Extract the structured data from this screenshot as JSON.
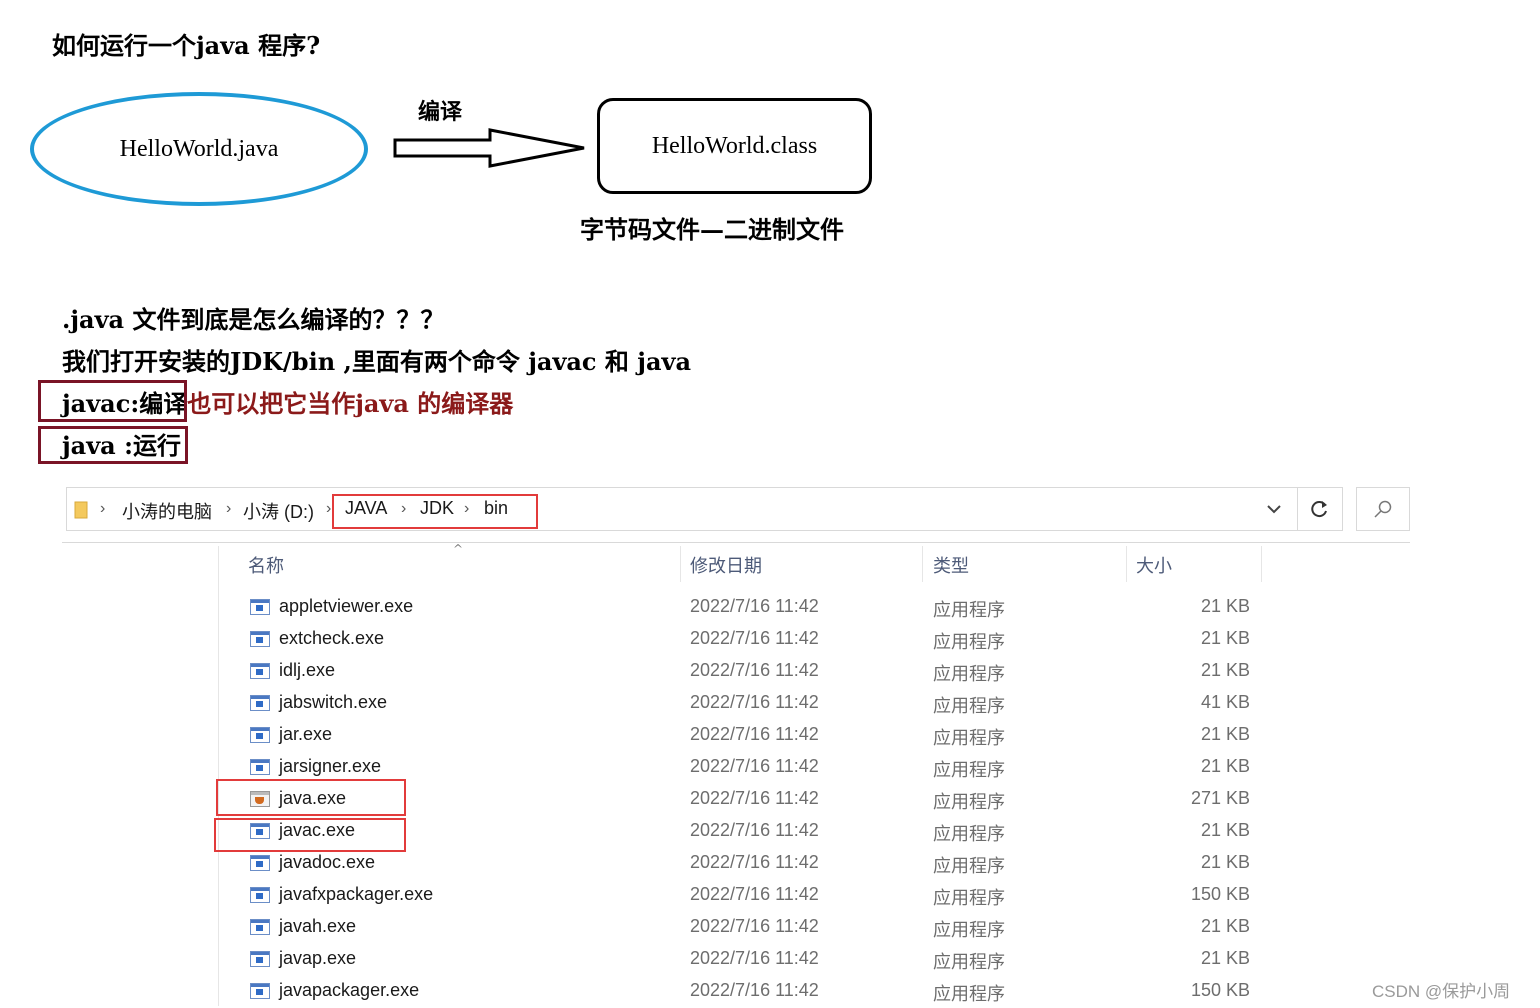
{
  "diagram": {
    "title": "如何运行一个java 程序?",
    "source_file": "HelloWorld.java",
    "arrow_label": "编译",
    "class_file": "HelloWorld.class",
    "class_note": "字节码文件—二进制文件"
  },
  "notes": {
    "question": ".java 文件到底是怎么编译的？？？",
    "jdk_line": "我们打开安装的JDK/bin ,里面有两个命令 javac 和 java",
    "javac_label": "javac:编译",
    "javac_note": "也可以把它当作java 的编译器",
    "java_label": "java :运行"
  },
  "explorer": {
    "breadcrumb": [
      "小涛的电脑",
      "小涛 (D:)",
      "JAVA",
      "JDK",
      "bin"
    ],
    "columns": {
      "name": "名称",
      "date": "修改日期",
      "type": "类型",
      "size": "大小"
    },
    "files": [
      {
        "name": "appletviewer.exe",
        "date": "2022/7/16 11:42",
        "type": "应用程序",
        "size": "21 KB",
        "icon": "exe-icon"
      },
      {
        "name": "extcheck.exe",
        "date": "2022/7/16 11:42",
        "type": "应用程序",
        "size": "21 KB",
        "icon": "exe-icon"
      },
      {
        "name": "idlj.exe",
        "date": "2022/7/16 11:42",
        "type": "应用程序",
        "size": "21 KB",
        "icon": "exe-icon"
      },
      {
        "name": "jabswitch.exe",
        "date": "2022/7/16 11:42",
        "type": "应用程序",
        "size": "41 KB",
        "icon": "exe-icon"
      },
      {
        "name": "jar.exe",
        "date": "2022/7/16 11:42",
        "type": "应用程序",
        "size": "21 KB",
        "icon": "exe-icon"
      },
      {
        "name": "jarsigner.exe",
        "date": "2022/7/16 11:42",
        "type": "应用程序",
        "size": "21 KB",
        "icon": "exe-icon"
      },
      {
        "name": "java.exe",
        "date": "2022/7/16 11:42",
        "type": "应用程序",
        "size": "271 KB",
        "icon": "java-cup-icon"
      },
      {
        "name": "javac.exe",
        "date": "2022/7/16 11:42",
        "type": "应用程序",
        "size": "21 KB",
        "icon": "exe-icon"
      },
      {
        "name": "javadoc.exe",
        "date": "2022/7/16 11:42",
        "type": "应用程序",
        "size": "21 KB",
        "icon": "exe-icon"
      },
      {
        "name": "javafxpackager.exe",
        "date": "2022/7/16 11:42",
        "type": "应用程序",
        "size": "150 KB",
        "icon": "exe-icon"
      },
      {
        "name": "javah.exe",
        "date": "2022/7/16 11:42",
        "type": "应用程序",
        "size": "21 KB",
        "icon": "exe-icon"
      },
      {
        "name": "javap.exe",
        "date": "2022/7/16 11:42",
        "type": "应用程序",
        "size": "21 KB",
        "icon": "exe-icon"
      },
      {
        "name": "javapackager.exe",
        "date": "2022/7/16 11:42",
        "type": "应用程序",
        "size": "150 KB",
        "icon": "exe-icon"
      }
    ]
  },
  "watermark": "CSDN @保护小周",
  "colors": {
    "ellipse": "#1e9ad6",
    "note_red": "#8b1a1a",
    "frame_maroon": "#7a1426",
    "highlight_red": "#e23b3b"
  }
}
